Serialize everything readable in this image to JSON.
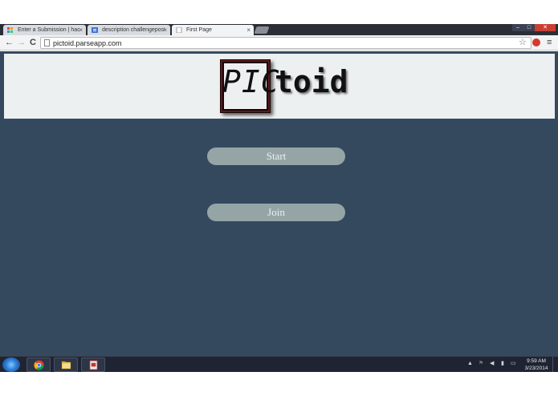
{
  "browser": {
    "tabs": [
      {
        "title": "Enter a Submission | hacke",
        "icon": "hackerleague-icon",
        "active": false
      },
      {
        "title": "description challengepost",
        "icon": "docs-icon",
        "active": false
      },
      {
        "title": "First Page",
        "icon": "page-icon",
        "active": true
      }
    ],
    "tab_close_glyph": "×",
    "address": {
      "url": "pictoid.parseapp.com"
    },
    "nav": {
      "back": "←",
      "forward": "→",
      "reload": "C"
    },
    "star_glyph": "☆",
    "menu_glyph": "≡",
    "window_controls": {
      "minimize": "–",
      "maximize": "□",
      "close": "✕"
    }
  },
  "page": {
    "logo": {
      "boxed_text": "PIC",
      "rest_text": "toid"
    },
    "buttons": {
      "start_label": "Start",
      "join_label": "Join"
    },
    "colors": {
      "background": "#34495e",
      "banner": "#ecf0f1",
      "button": "#95a5a6",
      "button_text": "#ecf0f1"
    }
  },
  "taskbar": {
    "pinned": [
      "chrome-icon",
      "explorer-icon",
      "app-icon"
    ],
    "tray_glyphs": {
      "up_arrow": "▲",
      "flag": "⚑",
      "volume": "◀",
      "network": "▮",
      "display": "▭"
    },
    "clock": {
      "time": "9:59 AM",
      "date": "3/23/2014"
    }
  }
}
